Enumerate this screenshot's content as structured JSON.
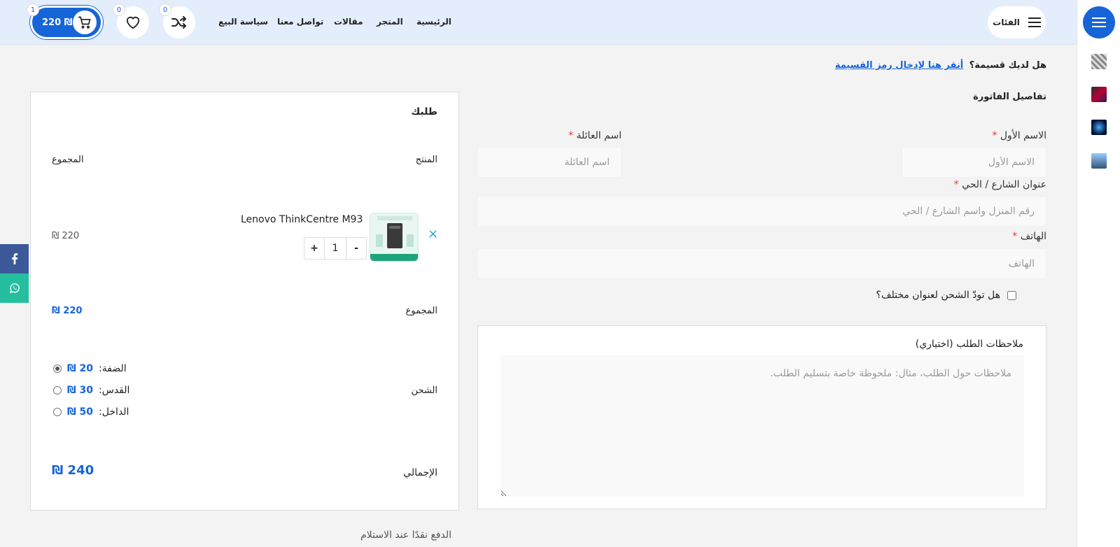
{
  "header": {
    "categories_label": "الفئات",
    "nav": [
      "الرئيسية",
      "المتجر",
      "مقالات",
      "تواصل معنا",
      "سياسة البيع"
    ],
    "compare_count": "0",
    "wishlist_count": "0",
    "cart_count": "1",
    "cart_total": "220 ₪"
  },
  "coupon": {
    "question": "هل لديك قسيمة؟",
    "link": "أنقر هنا لإدخال رمز القسيمة"
  },
  "billing": {
    "title": "تفاصيل الفاتورة",
    "first_name_label": "الاسم الأول",
    "first_name_placeholder": "الاسم الأول",
    "last_name_label": "اسم العائلة",
    "last_name_placeholder": "اسم العائلة",
    "address_label": "عنوان الشارع / الحي",
    "address_placeholder": "رقم المنزل واسم الشارع / الحي",
    "phone_label": "الهاتف",
    "phone_placeholder": "الهاتف",
    "required_mark": "*",
    "ship_different": "هل تودّ الشحن لعنوان مختلف؟",
    "notes_label": "ملاحظات الطلب (اختياري)",
    "notes_placeholder": "ملاحظات حول الطلب، مثال: ملحوظة خاصة بتسليم الطلب."
  },
  "order": {
    "title": "طلبك",
    "col_product": "المنتج",
    "col_total": "المجموع",
    "product_name": "Lenovo ThinkCentre M93",
    "remove_symbol": "×",
    "qty_minus": "-",
    "qty_value": "1",
    "qty_plus": "+",
    "line_total": "220 ₪",
    "subtotal_label": "المجموع",
    "subtotal_value": "220 ₪",
    "shipping_label": "الشحن",
    "shipping_options": [
      {
        "name": "الضفة:",
        "price": "20 ₪",
        "selected": true
      },
      {
        "name": "القدس:",
        "price": "30 ₪",
        "selected": false
      },
      {
        "name": "الداخل:",
        "price": "50 ₪",
        "selected": false
      }
    ],
    "total_label": "الإجمالي",
    "total_value": "240 ₪"
  },
  "payment": {
    "cod_label": "الدفع نقدًا عند الاستلام"
  },
  "colors": {
    "accent": "#1565d8",
    "header_bg": "#e3edfb",
    "facebook": "#3b5998",
    "whatsapp": "#25bfa0",
    "required": "#e53935"
  },
  "icons": {
    "menu": "hamburger-icon",
    "compare": "shuffle-icon",
    "wishlist": "heart-icon",
    "cart": "cart-icon",
    "facebook": "facebook-icon",
    "whatsapp": "whatsapp-icon"
  }
}
